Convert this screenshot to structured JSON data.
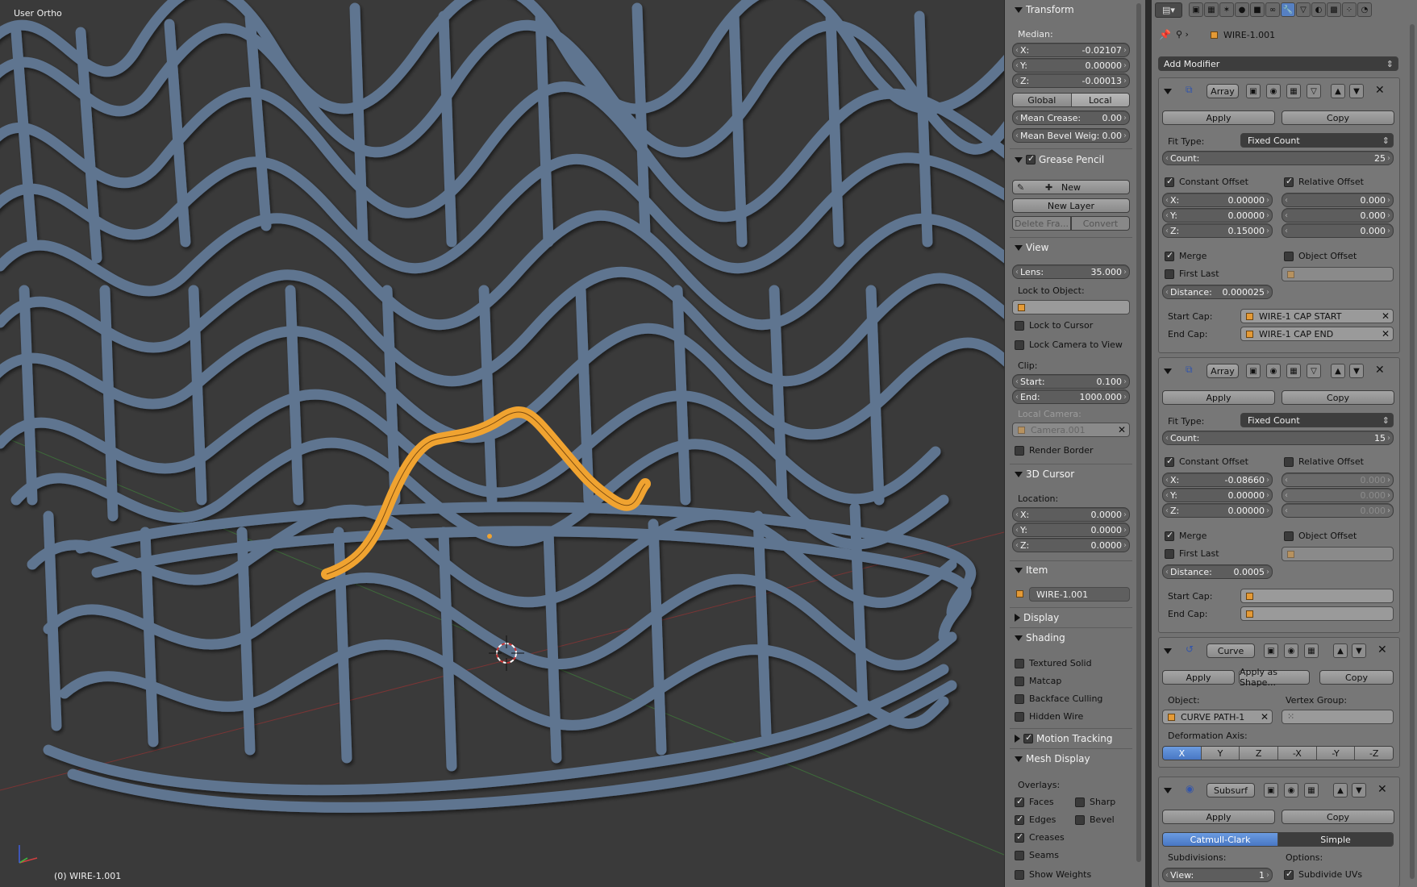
{
  "viewport": {
    "view_label": "User Ortho",
    "status": "(0) WIRE-1.001"
  },
  "transform": {
    "title": "Transform",
    "median": "Median:",
    "x_label": "X:",
    "x": "-0.02107",
    "y_label": "Y:",
    "y": "0.00000",
    "z_label": "Z:",
    "z": "-0.00013",
    "global": "Global",
    "local": "Local",
    "crease_label": "Mean Crease:",
    "crease": "0.00",
    "bevel_label": "Mean Bevel Weig:",
    "bevel": "0.00"
  },
  "grease": {
    "title": "Grease Pencil",
    "new": "New",
    "new_layer": "New Layer",
    "delete_frame": "Delete Fra...",
    "convert": "Convert"
  },
  "view": {
    "title": "View",
    "lens_label": "Lens:",
    "lens": "35.000",
    "lock_obj": "Lock to Object:",
    "lock_cursor": "Lock to Cursor",
    "lock_camera": "Lock Camera to View",
    "clip": "Clip:",
    "start_label": "Start:",
    "start": "0.100",
    "end_label": "End:",
    "end": "1000.000",
    "local_camera": "Local Camera:",
    "camera": "Camera.001",
    "render_border": "Render Border"
  },
  "cursor": {
    "title": "3D Cursor",
    "location": "Location:",
    "x_label": "X:",
    "x": "0.0000",
    "y_label": "Y:",
    "y": "0.0000",
    "z_label": "Z:",
    "z": "0.0000"
  },
  "item": {
    "title": "Item",
    "name": "WIRE-1.001"
  },
  "display": {
    "title": "Display"
  },
  "shading": {
    "title": "Shading",
    "textured": "Textured Solid",
    "matcap": "Matcap",
    "backface": "Backface Culling",
    "hidden_wire": "Hidden Wire"
  },
  "motion": {
    "title": "Motion Tracking"
  },
  "mesh_display": {
    "title": "Mesh Display",
    "overlays": "Overlays:",
    "faces": "Faces",
    "sharp": "Sharp",
    "edges": "Edges",
    "bevel": "Bevel",
    "creases": "Creases",
    "seams": "Seams",
    "show_weights": "Show Weights"
  },
  "props": {
    "object_name": "WIRE-1.001",
    "add_modifier": "Add Modifier"
  },
  "mod1": {
    "name": "Array",
    "apply": "Apply",
    "copy": "Copy",
    "fit_label": "Fit Type:",
    "fit": "Fixed Count",
    "count_label": "Count:",
    "count": "25",
    "const_offset": "Constant Offset",
    "rel_offset": "Relative Offset",
    "x_label": "X:",
    "x": "0.00000",
    "y_label": "Y:",
    "y": "0.00000",
    "z_label": "Z:",
    "z": "0.15000",
    "rx": "0.000",
    "ry": "0.000",
    "rz": "0.000",
    "merge": "Merge",
    "obj_offset": "Object Offset",
    "first_last": "First Last",
    "dist_label": "Distance:",
    "dist": "0.000025",
    "start_cap_label": "Start Cap:",
    "start_cap": "WIRE-1 CAP START",
    "end_cap_label": "End Cap:",
    "end_cap": "WIRE-1 CAP END"
  },
  "mod2": {
    "name": "Array",
    "apply": "Apply",
    "copy": "Copy",
    "fit_label": "Fit Type:",
    "fit": "Fixed Count",
    "count_label": "Count:",
    "count": "15",
    "const_offset": "Constant Offset",
    "rel_offset": "Relative Offset",
    "x_label": "X:",
    "x": "-0.08660",
    "y_label": "Y:",
    "y": "0.00000",
    "z_label": "Z:",
    "z": "0.00000",
    "rx": "0.000",
    "ry": "0.000",
    "rz": "0.000",
    "merge": "Merge",
    "obj_offset": "Object Offset",
    "first_last": "First Last",
    "dist_label": "Distance:",
    "dist": "0.0005",
    "start_cap_label": "Start Cap:",
    "end_cap_label": "End Cap:"
  },
  "mod3": {
    "name": "Curve",
    "apply": "Apply",
    "apply_shape": "Apply as Shape...",
    "copy": "Copy",
    "object_label": "Object:",
    "object": "CURVE PATH-1",
    "vgroup_label": "Vertex Group:",
    "axis_label": "Deformation Axis:",
    "axes": [
      "X",
      "Y",
      "Z",
      "-X",
      "-Y",
      "-Z"
    ]
  },
  "mod4": {
    "name": "Subsurf",
    "apply": "Apply",
    "copy": "Copy",
    "catmull": "Catmull-Clark",
    "simple": "Simple",
    "subdiv_label": "Subdivisions:",
    "options_label": "Options:",
    "view_label": "View:",
    "view": "1",
    "subdivide_uvs": "Subdivide UVs"
  },
  "colors": {
    "wire": "#5f7590",
    "selected": "#f0a330",
    "viewport_bg": "#3a3a3a"
  }
}
